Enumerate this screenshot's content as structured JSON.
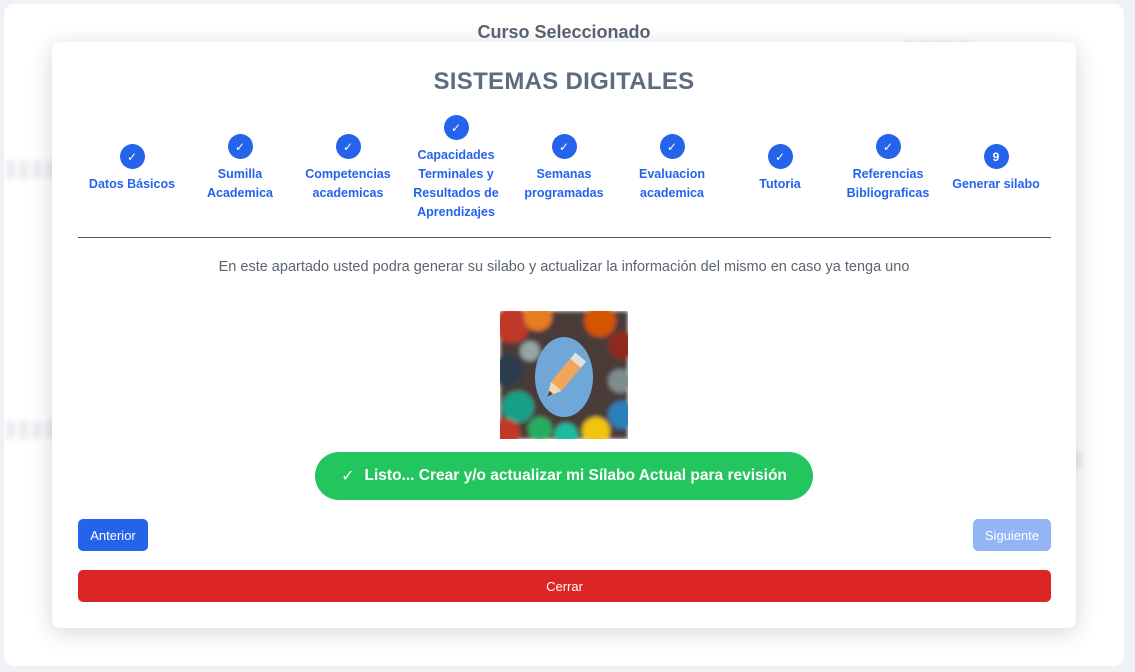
{
  "page": {
    "header_title": "Curso Seleccionado"
  },
  "modal": {
    "course_title": "SISTEMAS DIGITALES",
    "steps": [
      {
        "marker": "✓",
        "label": "Datos Básicos",
        "status": "complete"
      },
      {
        "marker": "✓",
        "label": "Sumilla Academica",
        "status": "complete"
      },
      {
        "marker": "✓",
        "label": "Competencias academicas",
        "status": "complete"
      },
      {
        "marker": "✓",
        "label": "Capacidades Terminales y Resultados de Aprendizajes",
        "status": "complete"
      },
      {
        "marker": "✓",
        "label": "Semanas programadas",
        "status": "complete"
      },
      {
        "marker": "✓",
        "label": "Evaluacion academica",
        "status": "complete"
      },
      {
        "marker": "✓",
        "label": "Tutoria",
        "status": "complete"
      },
      {
        "marker": "✓",
        "label": "Referencias Bibliograficas",
        "status": "complete"
      },
      {
        "marker": "9",
        "label": "Generar silabo",
        "status": "current"
      }
    ],
    "instructions": "En este apartado usted podra generar su silabo y actualizar la información del mismo en caso ya tenga uno",
    "illustration_icon": "pencil-icon",
    "generate_button": "Listo... Crear y/o actualizar mi Sílabo Actual para revisión",
    "prev_button": "Anterior",
    "next_button": "Siguiente",
    "close_button": "Cerrar"
  },
  "colors": {
    "primary": "#2563eb",
    "success": "#22c55e",
    "danger": "#dc2626",
    "disabled": "#93b4f5"
  }
}
